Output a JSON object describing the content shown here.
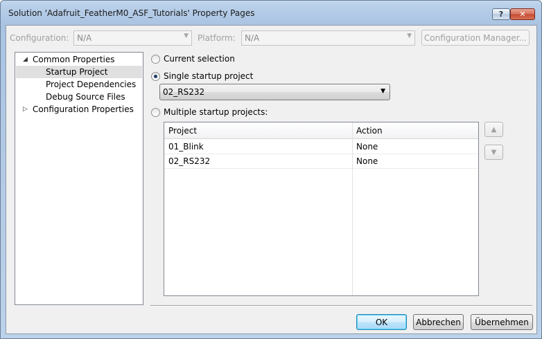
{
  "window": {
    "title": "Solution 'Adafruit_FeatherM0_ASF_Tutorials' Property Pages",
    "help_button": "?",
    "close_button": "✕"
  },
  "toolbar": {
    "configuration_label": "Configuration:",
    "configuration_value": "N/A",
    "platform_label": "Platform:",
    "platform_value": "N/A",
    "config_manager_button": "Configuration Manager..."
  },
  "tree": {
    "items": [
      {
        "label": "Common Properties",
        "expanded": true,
        "icon": "triangle-down-icon"
      },
      {
        "label": "Startup Project",
        "selected": true
      },
      {
        "label": "Project Dependencies"
      },
      {
        "label": "Debug Source Files"
      },
      {
        "label": "Configuration Properties",
        "expanded": false,
        "icon": "triangle-right-icon"
      }
    ]
  },
  "options": {
    "current_selection": "Current selection",
    "single_startup": "Single startup project",
    "single_startup_value": "02_RS232",
    "multiple_startup": "Multiple startup projects:",
    "selected": "single_startup"
  },
  "grid": {
    "columns": [
      "Project",
      "Action"
    ],
    "rows": [
      {
        "project": "01_Blink",
        "action": "None"
      },
      {
        "project": "02_RS232",
        "action": "None"
      }
    ]
  },
  "move_buttons": {
    "up_icon": "arrow-up-icon",
    "down_icon": "arrow-down-icon"
  },
  "buttons": {
    "ok": "OK",
    "cancel": "Abbrechen",
    "apply": "Übernehmen"
  },
  "colors": {
    "title_gradient": "#b9cfe9",
    "close_button": "#c24a31",
    "selection": "#e0e0e0",
    "default_button": "#3c7fb1"
  }
}
